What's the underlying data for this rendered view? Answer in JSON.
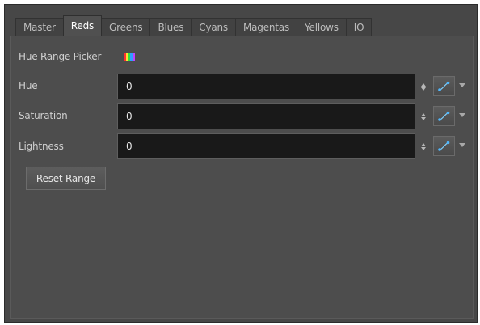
{
  "tabs": [
    {
      "label": "Master",
      "active": false
    },
    {
      "label": "Reds",
      "active": true
    },
    {
      "label": "Greens",
      "active": false
    },
    {
      "label": "Blues",
      "active": false
    },
    {
      "label": "Cyans",
      "active": false
    },
    {
      "label": "Magentas",
      "active": false
    },
    {
      "label": "Yellows",
      "active": false
    },
    {
      "label": "IO",
      "active": false
    }
  ],
  "hue_range_picker": {
    "label": "Hue Range Picker",
    "icon": "color-spectrum-icon",
    "icon_colors": [
      "#ff3030",
      "#ffe030",
      "#30e040",
      "#30a0ff",
      "#c040ff"
    ]
  },
  "fields": {
    "hue": {
      "label": "Hue",
      "value": "0"
    },
    "saturation": {
      "label": "Saturation",
      "value": "0"
    },
    "lightness": {
      "label": "Lightness",
      "value": "0"
    }
  },
  "icons": {
    "spinner": "spinner-icon",
    "curve": "curve-function-icon",
    "dropdown": "chevron-down-icon"
  },
  "reset_button": {
    "label": "Reset Range"
  },
  "colors": {
    "panel_bg": "#4d4d4d",
    "field_bg": "#191919",
    "text": "#cfcfcf",
    "active_tab_text": "#ffffff"
  }
}
